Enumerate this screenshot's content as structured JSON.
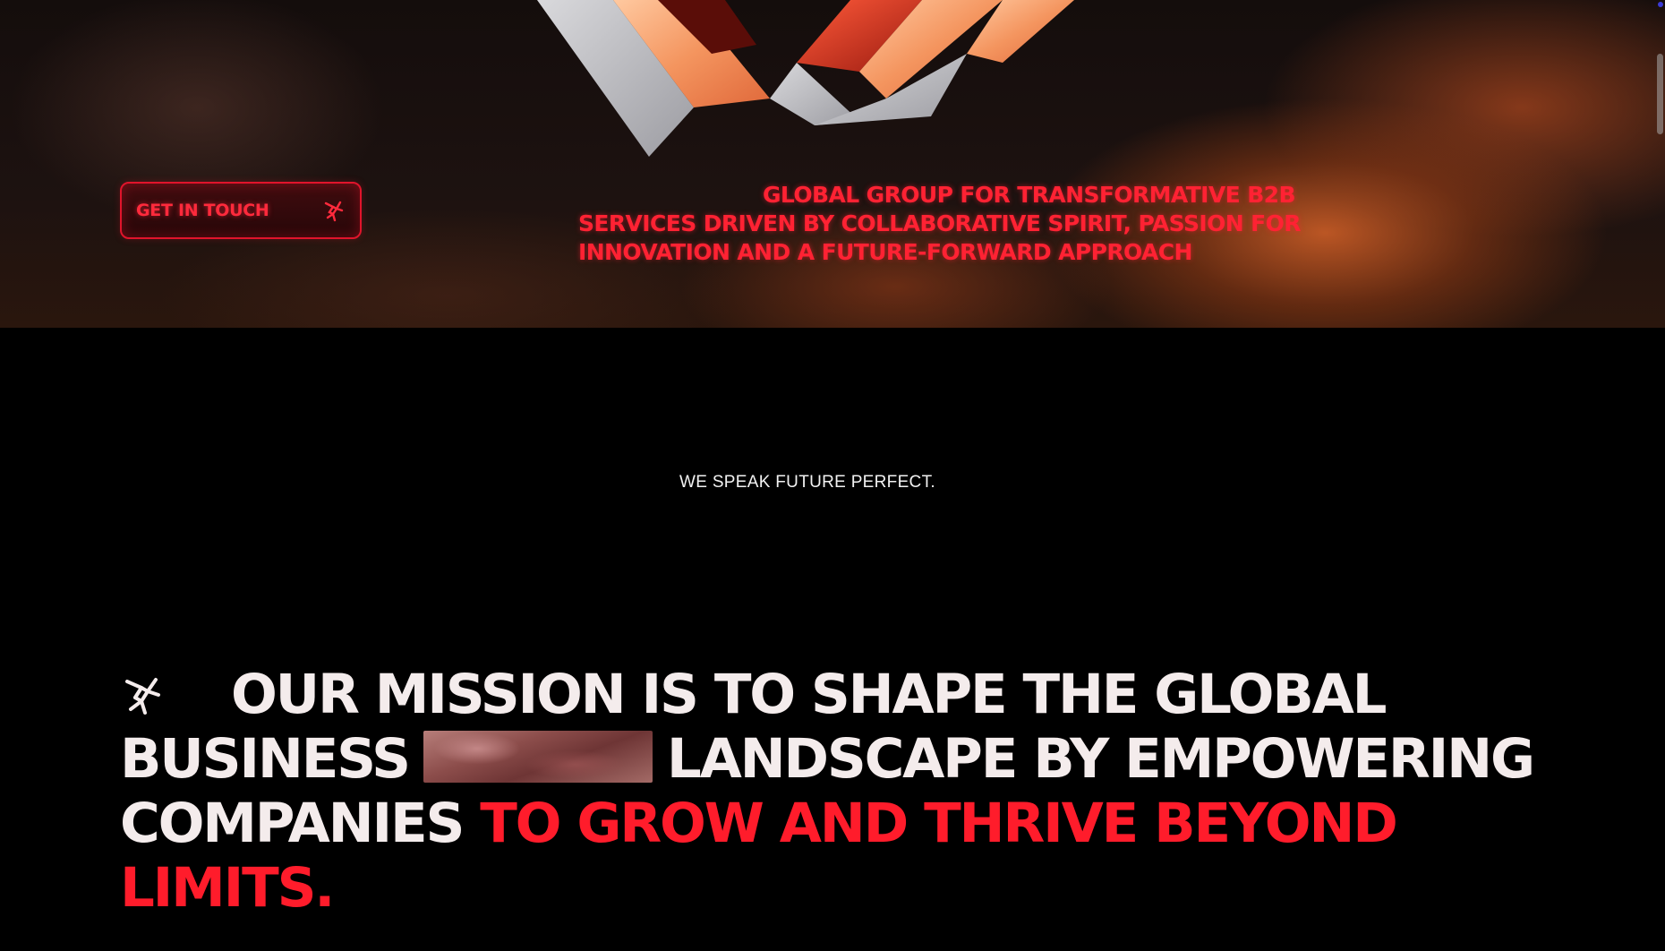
{
  "hero": {
    "cta": {
      "label": "GET IN TOUCH",
      "icon": "brand-mark-icon"
    },
    "tagline_lines": [
      "GLOBAL GROUP FOR TRANSFORMATIVE B2B",
      "SERVICES DRIVEN BY COLLABORATIVE SPIRIT, PASSION FOR",
      "INNOVATION AND A FUTURE-FORWARD APPROACH"
    ]
  },
  "kicker": "WE SPEAK FUTURE PERFECT.",
  "mission": {
    "icon": "brand-mark-icon",
    "line1": "OUR MISSION IS TO SHAPE THE GLOBAL",
    "line2_start": "BUSINESS",
    "line2_end": "LANDSCAPE BY EMPOWERING",
    "line3_start": "COMPANIES",
    "line3_accent": "TO GROW AND THRIVE BEYOND",
    "line4_accent": "LIMITS."
  },
  "colors": {
    "accent": "#ff1c2b",
    "background": "#000000",
    "text": "#f4ecec"
  }
}
